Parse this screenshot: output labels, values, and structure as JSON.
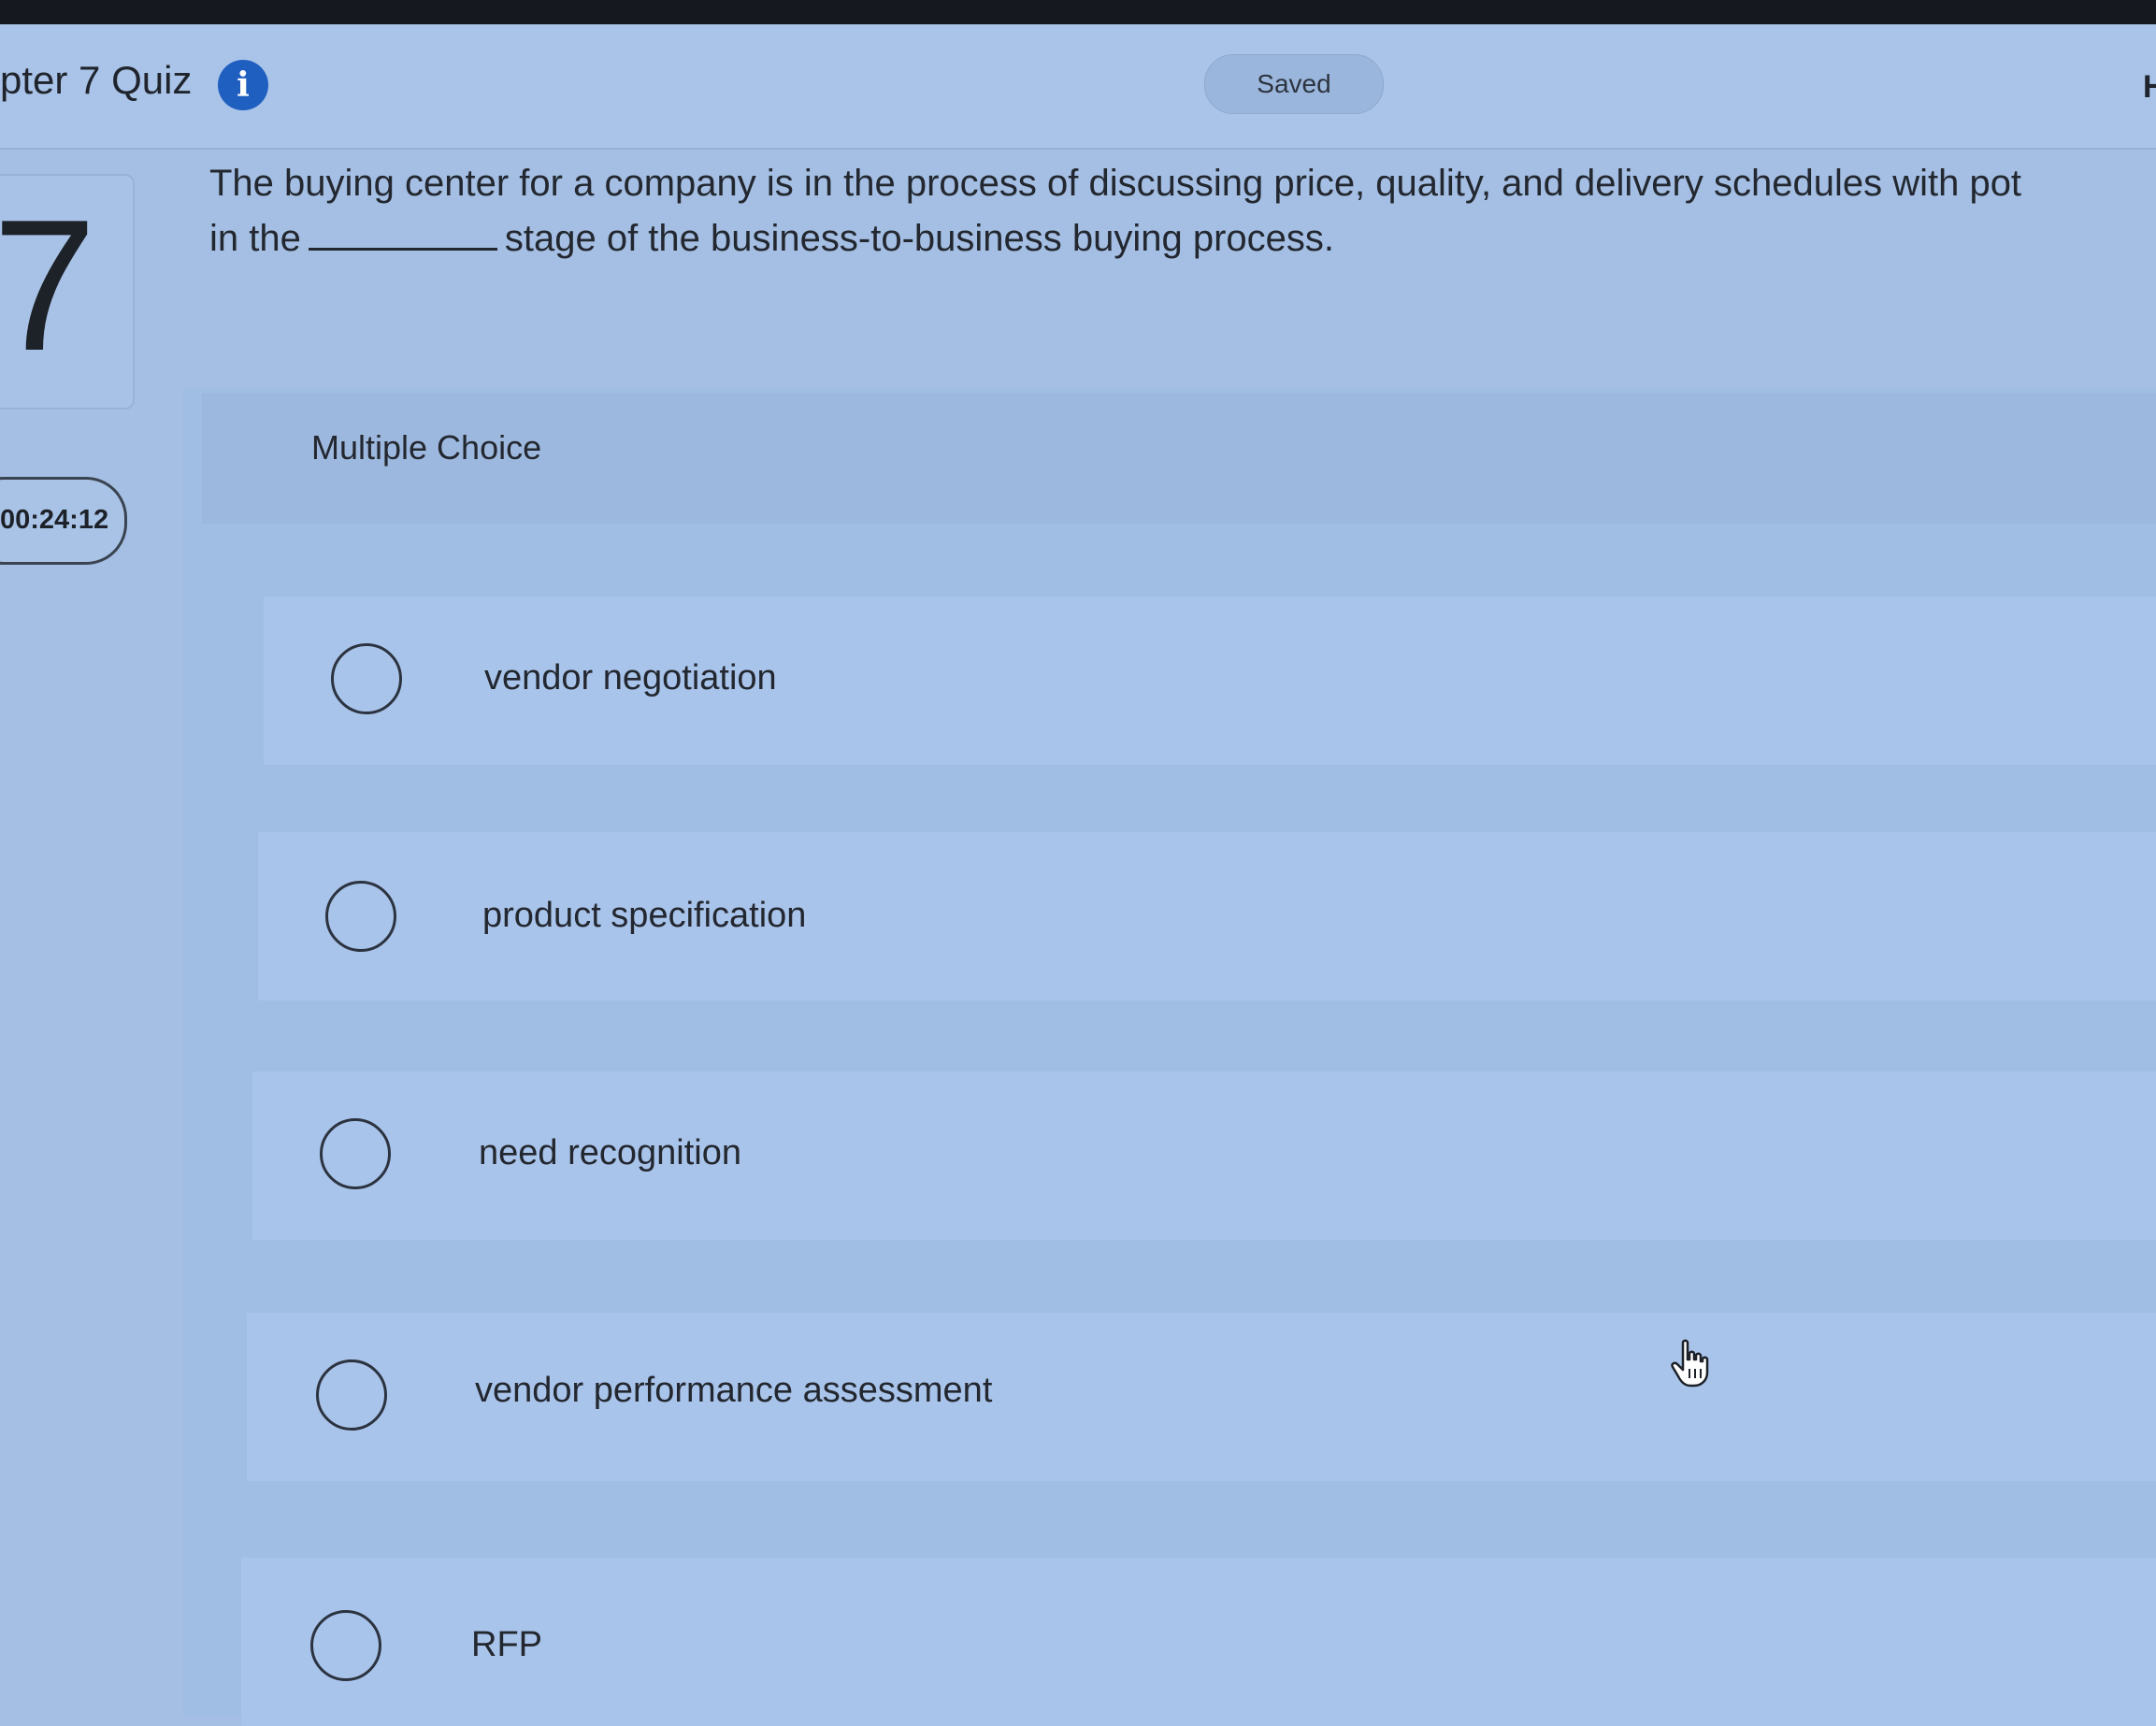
{
  "header": {
    "quiz_title": "pter 7 Quiz",
    "info_icon": "info-icon",
    "saved_label": "Saved",
    "edge_letter": "H"
  },
  "sidebar": {
    "question_number": "7",
    "timer": "00:24:12"
  },
  "question": {
    "line1": "The buying center for a company is in the process of discussing price, quality, and delivery schedules with pot",
    "line2_before": "in the",
    "line2_after": "stage of the business-to-business buying process."
  },
  "answer_panel": {
    "type_label": "Multiple Choice",
    "options": [
      {
        "label": "vendor negotiation"
      },
      {
        "label": "product specification"
      },
      {
        "label": "need recognition"
      },
      {
        "label": "vendor performance assessment"
      },
      {
        "label": "RFP"
      }
    ]
  },
  "colors": {
    "page_background": "#a4bfe3",
    "info_icon": "#1f5fc0",
    "text": "#23272f"
  }
}
